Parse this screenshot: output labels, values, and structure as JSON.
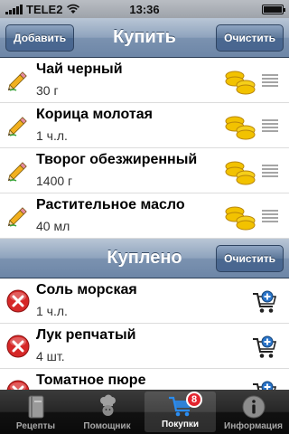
{
  "status_bar": {
    "carrier": "TELE2",
    "time": "13:36"
  },
  "buy_section": {
    "title": "Купить",
    "add_label": "Добавить",
    "clear_label": "Очистить",
    "items": [
      {
        "name": "Чай черный",
        "qty": "30 г"
      },
      {
        "name": "Корица молотая",
        "qty": "1 ч.л."
      },
      {
        "name": "Творог обезжиренный",
        "qty": "1400 г"
      },
      {
        "name": "Растительное масло",
        "qty": "40 мл"
      }
    ]
  },
  "bought_section": {
    "title": "Куплено",
    "clear_label": "Очистить",
    "items": [
      {
        "name": "Соль морская",
        "qty": "1 ч.л."
      },
      {
        "name": "Лук репчатый",
        "qty": "4 шт."
      },
      {
        "name": "Томатное пюре",
        "qty": ""
      }
    ]
  },
  "tab_bar": {
    "tabs": [
      {
        "label": "Рецепты",
        "icon": "book-icon"
      },
      {
        "label": "Помощник",
        "icon": "chef-icon"
      },
      {
        "label": "Покупки",
        "icon": "cart-icon",
        "badge": "8",
        "active": true
      },
      {
        "label": "Информация",
        "icon": "info-icon"
      }
    ]
  },
  "colors": {
    "nav_blue": "#6d86a7",
    "badge_red": "#e3252f",
    "coin_gold": "#f2c200",
    "remove_red": "#d62828",
    "cart_blue": "#2a74c9"
  }
}
